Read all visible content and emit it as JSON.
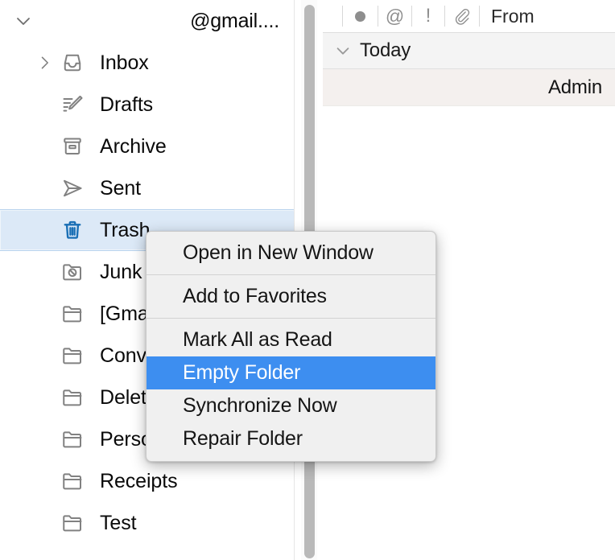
{
  "account": {
    "name": "@gmail....",
    "disclosure_icon": "chevron-down-icon"
  },
  "sidebar": {
    "items": [
      {
        "label": "Inbox",
        "icon": "inbox-icon",
        "has_disclosure": true,
        "selected": false
      },
      {
        "label": "Drafts",
        "icon": "drafts-icon",
        "has_disclosure": false,
        "selected": false
      },
      {
        "label": "Archive",
        "icon": "archive-icon",
        "has_disclosure": false,
        "selected": false
      },
      {
        "label": "Sent",
        "icon": "sent-icon",
        "has_disclosure": false,
        "selected": false
      },
      {
        "label": "Trash",
        "icon": "trash-icon",
        "has_disclosure": false,
        "selected": true
      },
      {
        "label": "Junk",
        "icon": "junk-icon",
        "has_disclosure": false,
        "selected": false
      },
      {
        "label": "[Gma",
        "icon": "folder-icon",
        "has_disclosure": false,
        "selected": false
      },
      {
        "label": "Conv",
        "icon": "folder-icon",
        "has_disclosure": false,
        "selected": false
      },
      {
        "label": "Delet",
        "icon": "folder-icon",
        "has_disclosure": false,
        "selected": false
      },
      {
        "label": "Perso",
        "icon": "folder-icon",
        "has_disclosure": false,
        "selected": false
      },
      {
        "label": "Receipts",
        "icon": "folder-icon",
        "has_disclosure": false,
        "selected": false
      },
      {
        "label": "Test",
        "icon": "folder-icon",
        "has_disclosure": false,
        "selected": false
      }
    ],
    "selected_color": "#dce9f7",
    "selected_icon_color": "#1a6fb5"
  },
  "scrollbar": {
    "orientation": "vertical",
    "thumb_color": "#b9b9b9"
  },
  "message_pane": {
    "columns": [
      {
        "label": "",
        "icon": "unread-dot-icon"
      },
      {
        "label": "@",
        "icon": "mention-at-icon"
      },
      {
        "label": "!",
        "icon": "priority-exclamation-icon"
      },
      {
        "label": "",
        "icon": "paperclip-icon"
      },
      {
        "label": "From",
        "icon": ""
      }
    ],
    "group": {
      "title": "Today",
      "chevron_icon": "chevron-down-icon"
    },
    "rows": [
      {
        "sender": "Admin"
      }
    ]
  },
  "context_menu": {
    "highlight_color": "#3d8ef0",
    "groups": [
      {
        "items": [
          {
            "label": "Open in New Window",
            "highlighted": false
          }
        ]
      },
      {
        "items": [
          {
            "label": "Add to Favorites",
            "highlighted": false
          }
        ]
      },
      {
        "items": [
          {
            "label": "Mark All as Read",
            "highlighted": false
          },
          {
            "label": "Empty Folder",
            "highlighted": true
          },
          {
            "label": "Synchronize Now",
            "highlighted": false
          },
          {
            "label": "Repair Folder",
            "highlighted": false
          }
        ]
      }
    ]
  }
}
